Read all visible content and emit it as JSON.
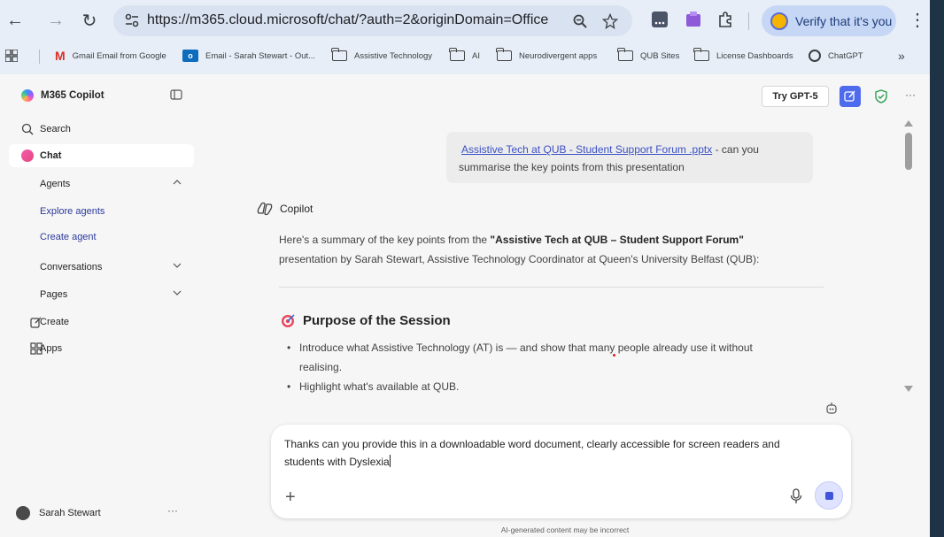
{
  "browser": {
    "url": "https://m365.cloud.microsoft/chat/?auth=2&originDomain=Office",
    "verify_label": "Verify that it's you",
    "bookmarks": [
      {
        "label": "Gmail Email from Google",
        "icon": "gmail-icon"
      },
      {
        "label": "Email - Sarah Stewart - Out...",
        "icon": "outlook-icon"
      },
      {
        "label": "Assistive Technology",
        "icon": "folder-icon"
      },
      {
        "label": "AI",
        "icon": "folder-icon"
      },
      {
        "label": "Neurodivergent apps",
        "icon": "folder-icon"
      },
      {
        "label": "QUB Sites",
        "icon": "folder-icon"
      },
      {
        "label": "License Dashboards",
        "icon": "folder-icon"
      },
      {
        "label": "ChatGPT",
        "icon": "chatgpt-icon"
      }
    ],
    "overflow": "»"
  },
  "sidebar": {
    "brand": "M365 Copilot",
    "items": [
      {
        "label": "Search"
      },
      {
        "label": "Chat"
      },
      {
        "label": "Agents"
      },
      {
        "label": "Explore agents"
      },
      {
        "label": "Create agent"
      },
      {
        "label": "Conversations"
      },
      {
        "label": "Pages"
      },
      {
        "label": "Create"
      },
      {
        "label": "Apps"
      }
    ],
    "user_name": "Sarah Stewart",
    "user_more": "···"
  },
  "header": {
    "try_label": "Try GPT-5",
    "more": "···"
  },
  "conversation": {
    "user_link": "Assistive Tech at QUB - Student Support Forum .pptx",
    "user_text": " - can you summarise the key points from this presentation",
    "assistant_name": "Copilot",
    "summary_pre": "Here's a summary of the key points from the ",
    "summary_bold": "\"Assistive Tech at QUB – Student Support Forum\"",
    "summary_post": " presentation by Sarah Stewart, Assistive Technology Coordinator at Queen's University Belfast (QUB):",
    "section_title": "Purpose of the Session",
    "bullets": [
      "Introduce what Assistive Technology (AT) is — and show that many people already use it without realising.",
      "Highlight what's available at QUB."
    ]
  },
  "composer": {
    "text": "Thanks can you provide this in a downloadable word document, clearly accessible for screen readers and students with Dyslexia",
    "disclaimer": "AI-generated content may be incorrect"
  },
  "colors": {
    "accent": "#4f6bed",
    "link": "#3b50c4",
    "shield": "#2e9e52"
  }
}
